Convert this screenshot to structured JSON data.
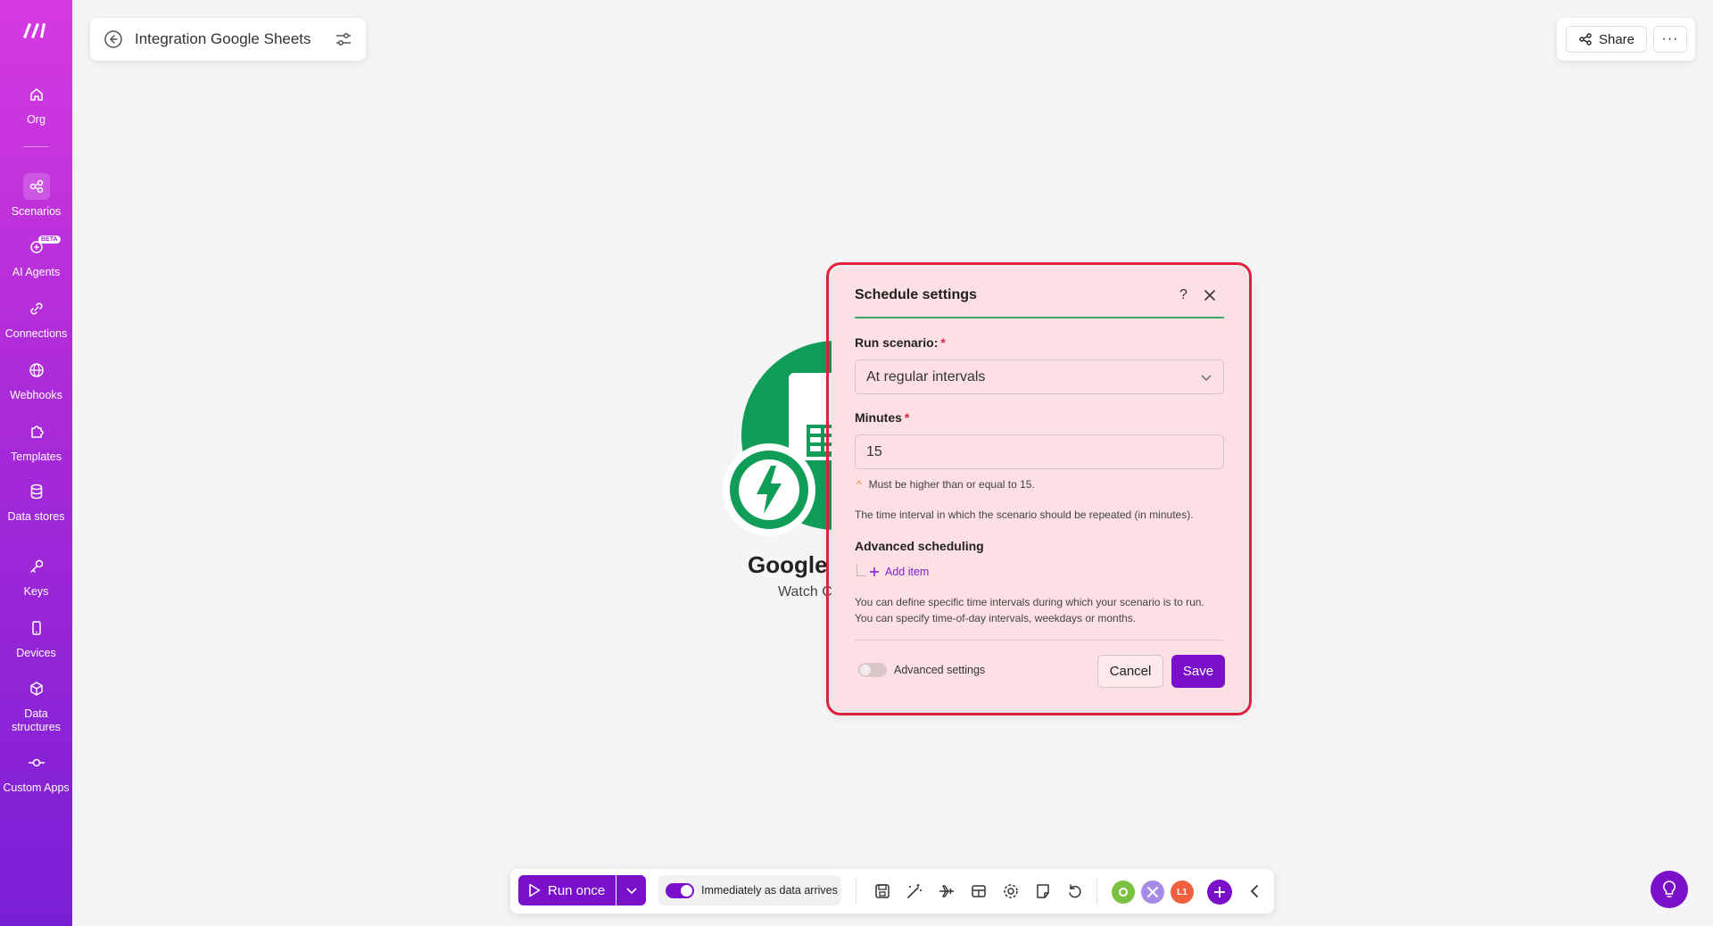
{
  "sidebar": {
    "items": [
      {
        "label": "Org",
        "icon": "home-icon"
      },
      {
        "label": "Scenarios",
        "icon": "share-nodes-icon"
      },
      {
        "label": "AI Agents",
        "icon": "ai-agent-icon",
        "badge": "BETA"
      },
      {
        "label": "Connections",
        "icon": "link-icon"
      },
      {
        "label": "Webhooks",
        "icon": "globe-icon"
      },
      {
        "label": "Templates",
        "icon": "puzzle-icon"
      },
      {
        "label": "Data stores",
        "icon": "database-icon"
      },
      {
        "label": "Keys",
        "icon": "key-icon"
      },
      {
        "label": "Devices",
        "icon": "phone-icon"
      },
      {
        "label": "Data structures",
        "icon": "cube-icon"
      },
      {
        "label": "Custom Apps",
        "icon": "commit-icon"
      }
    ],
    "active": "Scenarios"
  },
  "header": {
    "scenario_name": "Integration Google Sheets",
    "share_label": "Share",
    "more_label": "···"
  },
  "canvas": {
    "module_title": "Google S",
    "module_subtitle": "Watch Cl"
  },
  "dialog": {
    "title": "Schedule settings",
    "help": "?",
    "run_scenario_label": "Run scenario:",
    "run_scenario_value": "At regular intervals",
    "minutes_label": "Minutes",
    "required_mark": "*",
    "minutes_value": "15",
    "validation": "Must be higher than or equal to 15.",
    "minutes_help": "The time interval in which the scenario should be repeated (in minutes).",
    "advanced_scheduling_label": "Advanced scheduling",
    "add_item": "Add item",
    "advanced_help": "You can define specific time intervals during which your scenario is to run. You can specify time-of-day intervals, weekdays or months.",
    "advanced_settings_label": "Advanced settings",
    "advanced_settings_on": false,
    "cancel": "Cancel",
    "save": "Save"
  },
  "toolbar": {
    "run_once": "Run once",
    "schedule_label": "Immediately as data arrives",
    "schedule_on": true,
    "apps": [
      "L1"
    ]
  },
  "colors": {
    "brand_purple": "#7a10c9",
    "sidebar_top": "#d63ae0",
    "sidebar_bottom": "#7a1fd6",
    "sheets_green": "#0f9d58",
    "highlight_red": "#e8223d",
    "dialog_bg": "#fde0e3"
  }
}
